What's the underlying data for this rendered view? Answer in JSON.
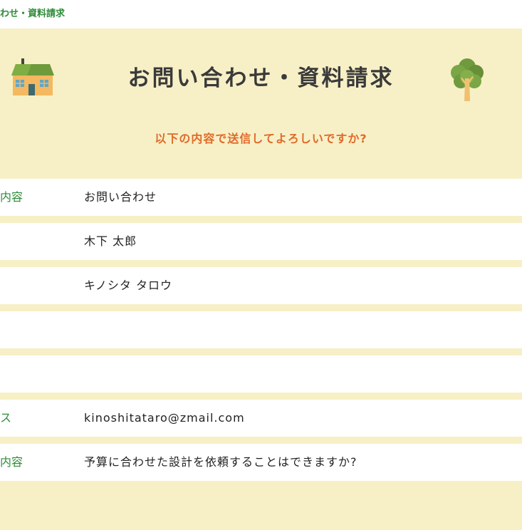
{
  "breadcrumb": "わせ・資料請求",
  "header": {
    "title": "お問い合わせ・資料請求",
    "subtitle": "以下の内容で送信してよろしいですか?"
  },
  "rows": [
    {
      "label": "内容",
      "value": "お問い合わせ"
    },
    {
      "label": "",
      "value": "木下 太郎"
    },
    {
      "label": "",
      "value": "キノシタ タロウ"
    },
    {
      "label": "",
      "value": ""
    },
    {
      "label": "",
      "value": ""
    },
    {
      "label": "ス",
      "value": "kinoshitataro@zmail.com"
    },
    {
      "label": "内容",
      "value": "予算に合わせた設計を依頼することはできますか?"
    }
  ],
  "colors": {
    "panel_bg": "#f7f0c6",
    "accent_green": "#2e8b3a",
    "accent_orange": "#e06a2a"
  },
  "icons": [
    "house-icon",
    "tree-icon"
  ]
}
